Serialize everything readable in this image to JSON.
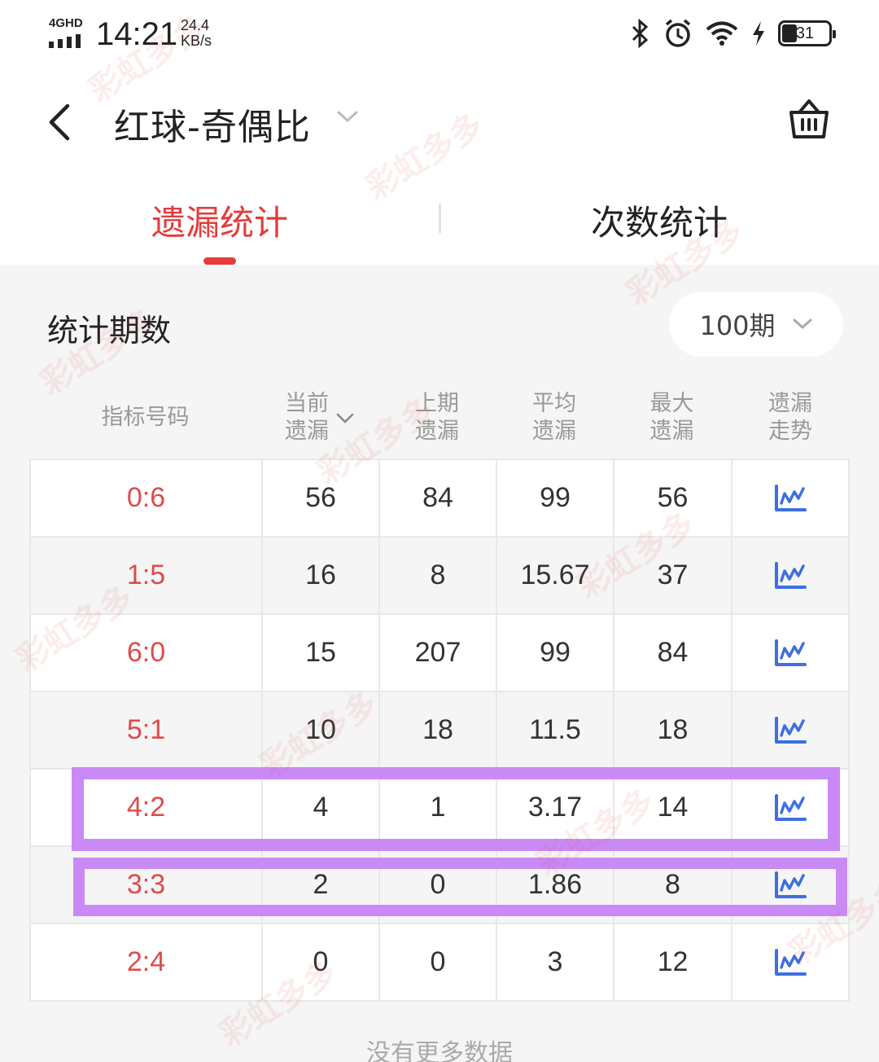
{
  "status_bar": {
    "network": "4GHD",
    "time": "14:21",
    "speed_value": "24.4",
    "speed_unit": "KB/s",
    "battery": "31",
    "icons": [
      "bluetooth-icon",
      "alarm-icon",
      "wifi-icon",
      "charging-icon",
      "battery-icon"
    ]
  },
  "header": {
    "title": "红球-奇偶比",
    "icons": {
      "back": "back-arrow-icon",
      "title_dropdown": "chevron-down-icon",
      "cart": "basket-icon"
    }
  },
  "tabs": [
    {
      "label": "遗漏统计",
      "active": true
    },
    {
      "label": "次数统计",
      "active": false
    }
  ],
  "period": {
    "label": "统计期数",
    "selected": "100期"
  },
  "table": {
    "headers": [
      {
        "line1": "指标号码",
        "line2": ""
      },
      {
        "line1": "当前",
        "line2": "遗漏",
        "sortable": true
      },
      {
        "line1": "上期",
        "line2": "遗漏"
      },
      {
        "line1": "平均",
        "line2": "遗漏"
      },
      {
        "line1": "最大",
        "line2": "遗漏"
      },
      {
        "line1": "遗漏",
        "line2": "走势"
      }
    ],
    "rows": [
      {
        "code": "0:6",
        "current": "56",
        "last": "84",
        "avg": "99",
        "max": "56"
      },
      {
        "code": "1:5",
        "current": "16",
        "last": "8",
        "avg": "15.67",
        "max": "37"
      },
      {
        "code": "6:0",
        "current": "15",
        "last": "207",
        "avg": "99",
        "max": "84"
      },
      {
        "code": "5:1",
        "current": "10",
        "last": "18",
        "avg": "11.5",
        "max": "18"
      },
      {
        "code": "4:2",
        "current": "4",
        "last": "1",
        "avg": "3.17",
        "max": "14"
      },
      {
        "code": "3:3",
        "current": "2",
        "last": "0",
        "avg": "1.86",
        "max": "8"
      },
      {
        "code": "2:4",
        "current": "0",
        "last": "0",
        "avg": "3",
        "max": "12"
      }
    ],
    "trend_icon": "trend-chart-icon"
  },
  "footer": {
    "no_more": "没有更多数据"
  },
  "watermark_text": "彩虹多多",
  "colors": {
    "accent": "#e63b3b",
    "code_red": "#e04b4b",
    "trend_blue": "#3d6fe0",
    "highlight": "#c98af5"
  }
}
